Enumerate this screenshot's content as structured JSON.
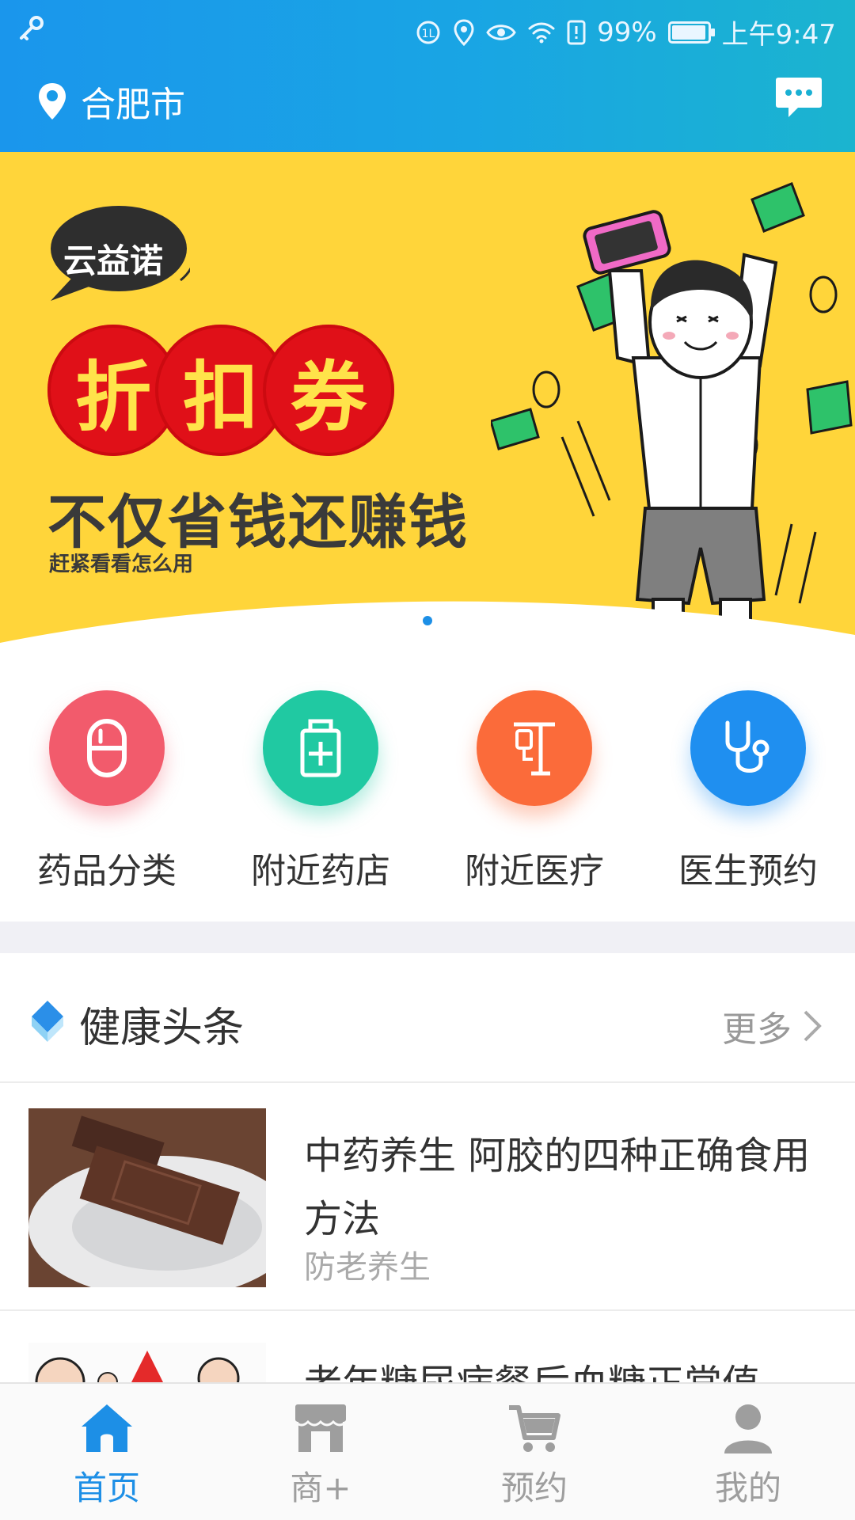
{
  "status_bar": {
    "battery": "99%",
    "time": "上午9:47"
  },
  "header": {
    "city": "合肥市"
  },
  "banner": {
    "brand": "云益诺",
    "chars": [
      "折",
      "扣",
      "券"
    ],
    "slogan": "不仅省钱还赚钱",
    "sub_slogan": "赶紧看看怎么用"
  },
  "shortcuts": [
    {
      "label": "药品分类",
      "color": "#f25b6c",
      "icon": "capsule-icon"
    },
    {
      "label": "附近药店",
      "color": "#20c9a2",
      "icon": "medicine-bottle-icon"
    },
    {
      "label": "附近医疗",
      "color": "#fb6b3a",
      "icon": "iv-drip-icon"
    },
    {
      "label": "医生预约",
      "color": "#1f8ff0",
      "icon": "stethoscope-icon"
    }
  ],
  "news": {
    "section_title": "健康头条",
    "more_label": "更多",
    "items": [
      {
        "title": "中药养生 阿胶的四种正确食用方法",
        "tag": "防老养生"
      },
      {
        "title": "老年糖尿病餐后血糖正常值"
      }
    ]
  },
  "tabbar": [
    {
      "label": "首页",
      "icon": "home-icon",
      "active": true
    },
    {
      "label": "商+",
      "icon": "store-icon",
      "active": false
    },
    {
      "label": "预约",
      "icon": "cart-icon",
      "active": false
    },
    {
      "label": "我的",
      "icon": "user-icon",
      "active": false
    }
  ],
  "colors": {
    "primary": "#1d8fe6",
    "banner_bg": "#ffd53a"
  }
}
